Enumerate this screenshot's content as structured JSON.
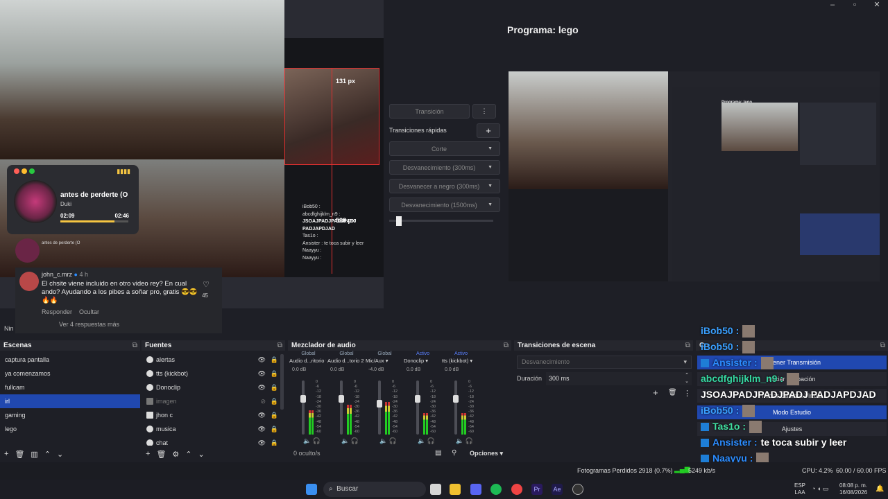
{
  "window_controls": {
    "minimize": "–",
    "maximize": "▫",
    "close": "✕"
  },
  "preview": {
    "dim_top": "131 px",
    "dim_bottom": "588 px",
    "player": {
      "title": "antes de perderte (O",
      "artist": "Duki",
      "elapsed": "02:09",
      "total": "02:46",
      "progress": 0.8
    },
    "small_label": "antes de perderte (O",
    "comment": {
      "user": "john_c.mrz",
      "time": "4 h",
      "text": "El chsite viene incluido en otro video rey? En cual ando? Ayudando a los pibes a soñar pro, gratis 😎😎🔥🔥",
      "likes": "45",
      "reply": "Responder",
      "hide": "Ocultar",
      "more": "Ver 4 respuestas más"
    },
    "chatlog": [
      "iBob50 :",
      "abcdfghijklm_n9 :",
      "JSOAJPADJPADJPADJ PADJAPDJAD",
      "Tas1o :",
      "Ansister : te toca subir y leer",
      "Naayyu :",
      "Naayyu :"
    ],
    "nin": "Nin"
  },
  "transitions_panel": {
    "transition_btn": "Transición",
    "quick_label": "Transiciones rápidas",
    "options": [
      "Corte",
      "Desvanecimiento (300ms)",
      "Desvanecer a negro (300ms)",
      "Desvanecimiento (1500ms)"
    ]
  },
  "program": {
    "title": "Programa: lego",
    "inner_title": "Programa: lego"
  },
  "docks": {
    "scenes": {
      "title": "Escenas",
      "items": [
        "captura pantalla",
        "ya comenzamos",
        "fullcam",
        "irl",
        "gaming",
        "lego"
      ],
      "active": 3
    },
    "sources": {
      "title": "Fuentes",
      "items": [
        "alertas",
        "tts (kickbot)",
        "Donoclip",
        "imagen",
        "jhon c",
        "musica",
        "chat"
      ]
    },
    "mixer": {
      "title": "Mezclador de audio",
      "hidden": "0 oculto/s",
      "options": "Opciones",
      "channels": [
        {
          "mode": "Global",
          "name": "Audio d...ritorio",
          "db": "0.0 dB",
          "level": 0.45,
          "fader": 0.3
        },
        {
          "mode": "Global",
          "name": "Audio d...torio 2",
          "db": "0.0 dB",
          "level": 0.55,
          "fader": 0.3
        },
        {
          "mode": "Global",
          "name": "Mic/Aux",
          "db": "-4.0 dB",
          "level": 0.6,
          "fader": 0.4
        },
        {
          "mode": "Activo",
          "name": "Donoclip",
          "db": "0.0 dB",
          "level": 0.4,
          "fader": 0.3
        },
        {
          "mode": "Activo",
          "name": "tts (kickbot)",
          "db": "0.0 dB",
          "level": 0.4,
          "fader": 0.3
        }
      ],
      "scale": [
        "0",
        "-6",
        "-12",
        "-18",
        "-24",
        "-30",
        "-36",
        "-42",
        "-48",
        "-54",
        "-60"
      ]
    },
    "scene_transitions": {
      "title": "Transiciones de escena",
      "selected": "Desvanecimiento",
      "duration_label": "Duración",
      "duration_value": "300 ms"
    },
    "controls": {
      "title": "Co",
      "items": [
        "Detener Transmisión",
        "Iniciar Grabación",
        "Iniciar Cámara Virtual",
        "Modo Estudio",
        "Ajustes"
      ]
    }
  },
  "chat_overlay": [
    {
      "user": "iBob50 :",
      "msg": "",
      "color": "#3aa0ff",
      "badge": false
    },
    {
      "user": "iBob50 :",
      "msg": "",
      "color": "#3aa0ff",
      "badge": false
    },
    {
      "user": "Ansister :",
      "msg": "",
      "color": "#2b8cff",
      "badge": true
    },
    {
      "user": "abcdfghijklm_n9 :",
      "msg": "",
      "color": "#35d6a0",
      "badge": false
    },
    {
      "user": "",
      "msg": "JSOAJPADJPADJPADJ PADJAPDJAD",
      "color": "#fff",
      "badge": false
    },
    {
      "user": "iBob50 :",
      "msg": "",
      "color": "#3aa0ff",
      "badge": false
    },
    {
      "user": "Tas1o :",
      "msg": "",
      "color": "#40e0a0",
      "badge": true
    },
    {
      "user": "Ansister :",
      "msg": "te toca subir y leer",
      "color": "#2b8cff",
      "badge": true
    },
    {
      "user": "Naayyu :",
      "msg": "",
      "color": "#2b8cff",
      "badge": true
    },
    {
      "user": "Naayyu :",
      "msg": "",
      "color": "#2b8cff",
      "badge": true
    }
  ],
  "status": {
    "frames": "Fotogramas Perdidos 2918 (0.7%)",
    "kbps": "5249 kb/s",
    "cpu": "CPU: 4.2%",
    "fps": "60.00 / 60.00 FPS"
  },
  "taskbar": {
    "search": "Buscar",
    "lang1": "ESP",
    "lang2": "LAA",
    "time": "08:08 p. m.",
    "date": "16/08/2026"
  }
}
